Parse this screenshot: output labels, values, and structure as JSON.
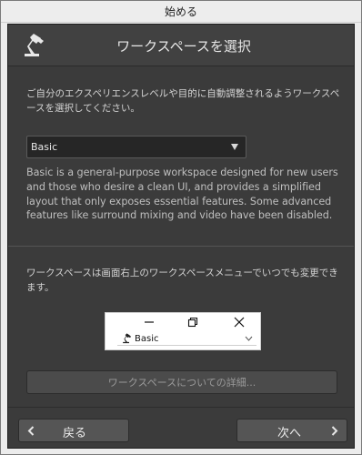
{
  "window": {
    "title": "始める"
  },
  "dialog": {
    "header": {
      "icon": "lamp-icon",
      "title": "ワークスペースを選択"
    },
    "intro": "ご自分のエクスペリエンスレベルや目的に自動調整されるようワークスペースを選択してください。",
    "workspace_select": {
      "selected": "Basic"
    },
    "description": "Basic is a general-purpose workspace designed for new users and those who desire a clean UI, and provides a simplified layout that only exposes essential features. Some advanced features like surround mixing and video have been disabled.",
    "note": "ワークスペースは画面右上のワークスペースメニューでいつでも変更できます。",
    "preview": {
      "workspace_label": "Basic",
      "controls": [
        "minimize-icon",
        "restore-icon",
        "close-icon"
      ]
    },
    "details_button": "ワークスペースについての詳細...",
    "footer": {
      "back_label": "戻る",
      "next_label": "次へ"
    }
  },
  "colors": {
    "dialog_bg": "#3b3b3b",
    "header_bg": "#414141",
    "text_primary": "#d4d4d4",
    "button_bg": "#555555",
    "dropdown_bg": "#262626"
  }
}
